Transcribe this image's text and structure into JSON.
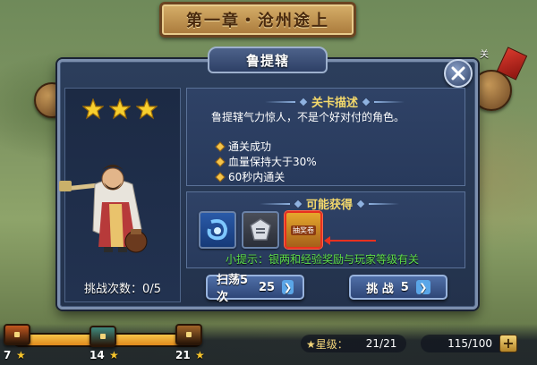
{
  "chapter_title": "第一章・沧州途上",
  "dialog": {
    "title": "鲁提辖",
    "stars": 3,
    "challenge_label": "挑战次数：",
    "challenge_value": "0/5",
    "description_header": "关卡描述",
    "description": "鲁提辖气力惊人，不是个好对付的角色。",
    "conditions": [
      "通关成功",
      "血量保持大于30%",
      "60秒内通关"
    ],
    "rewards_header": "可能获得",
    "rewards": [
      {
        "icon": "blue-ring-gem-icon"
      },
      {
        "icon": "silver-emblem-icon"
      },
      {
        "icon": "reward-scroll-icon",
        "label": "抽奖卷"
      }
    ],
    "tip": "小提示：银两和经验奖励与玩家等级有关",
    "sweep_button": "扫荡5次",
    "sweep_cost": "25",
    "challenge_button": "挑  战",
    "challenge_cost": "5"
  },
  "map": {
    "nodes": [
      {
        "label": ""
      },
      {
        "label": "关"
      }
    ]
  },
  "bottom_bar": {
    "progress_fraction": 0.95,
    "chests": [
      {
        "count": "7",
        "color": "#c2571f"
      },
      {
        "count": "14",
        "color": "#3f8a7f"
      },
      {
        "count": "21",
        "color": "#a4662a"
      }
    ],
    "star_level_label": "★星级：",
    "star_level_value": "21/21",
    "stamina_value": "115/100",
    "plus_label": "+"
  },
  "colors": {
    "accent_gold": "#f4d96b",
    "tip_green": "#5fe04b",
    "highlight_red": "#e8301f",
    "dialog_bg": "#2c3e5c"
  }
}
